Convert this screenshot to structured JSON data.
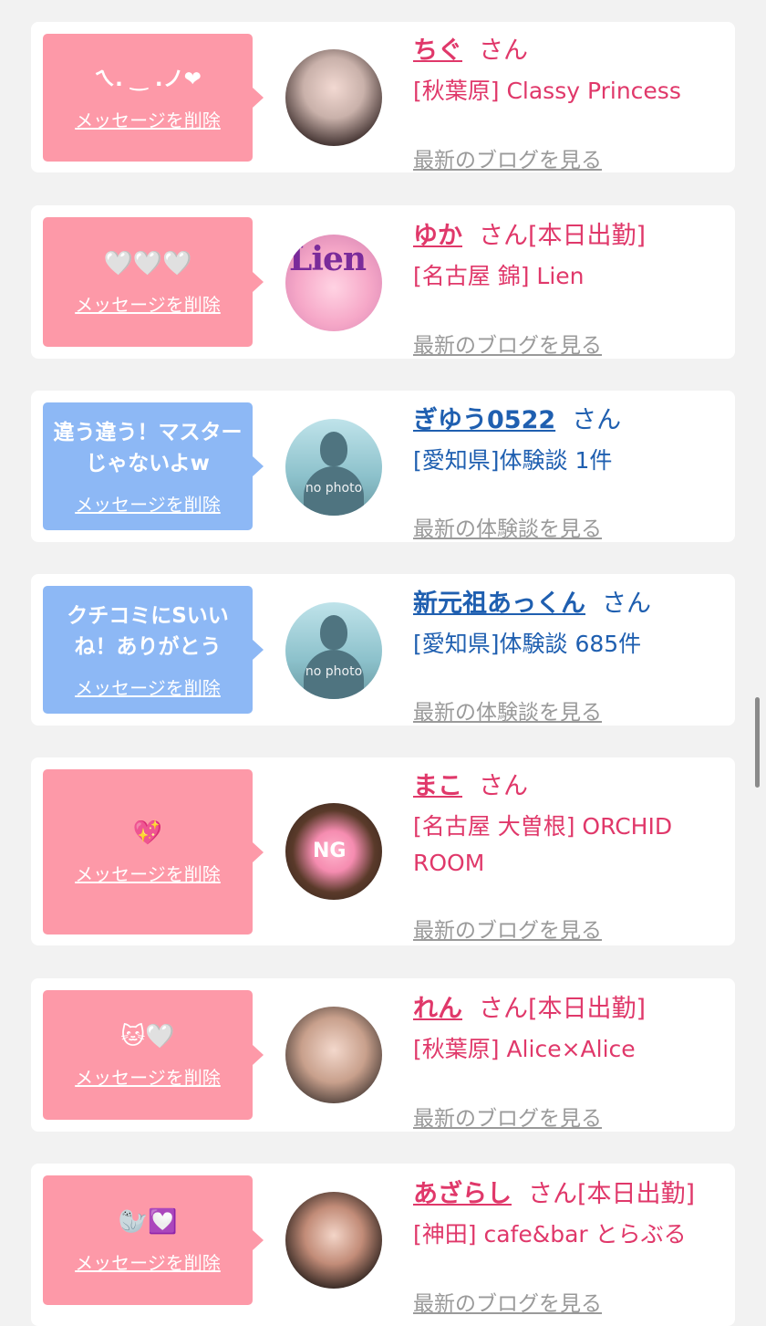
{
  "colors": {
    "pink_bubble": "#fd99a8",
    "blue_bubble": "#8db8f5",
    "pink_text": "#e0386a",
    "blue_text": "#1f5fb0"
  },
  "cards": [
    {
      "message": "ㄟ. ‿ .ノ❤",
      "delete_label": "メッセージを削除",
      "name": "ちぐ",
      "san": "さん",
      "status": "",
      "shop": "[秋葉原] Classy Princess",
      "more_link": "最新のブログを見る"
    },
    {
      "message": "🤍🤍🤍",
      "delete_label": "メッセージを削除",
      "name": "ゆか",
      "san": "さん",
      "status": "[本日出勤]",
      "shop": "[名古屋 錦] Lien",
      "more_link": "最新のブログを見る",
      "avatar_text": "Lien"
    },
    {
      "message": "違う違う！マスターじゃないよw",
      "delete_label": "メッセージを削除",
      "name": "ぎゆう0522",
      "san": "さん",
      "status": "",
      "shop": "[愛知県]体験談 1件",
      "more_link": "最新の体験談を見る",
      "avatar_text": "no photo"
    },
    {
      "message": "クチコミにSいいね！ありがとう",
      "delete_label": "メッセージを削除",
      "name": "新元祖あっくん",
      "san": "さん",
      "status": "",
      "shop": "[愛知県]体験談 685件",
      "more_link": "最新の体験談を見る",
      "avatar_text": "no photo"
    },
    {
      "message": "💖",
      "delete_label": "メッセージを削除",
      "name": "まこ",
      "san": "さん",
      "status": "",
      "shop": "[名古屋 大曽根] ORCHID ROOM",
      "more_link": "最新のブログを見る",
      "avatar_text": "NG"
    },
    {
      "message": "🐱🤍",
      "delete_label": "メッセージを削除",
      "name": "れん",
      "san": "さん",
      "status": "[本日出勤]",
      "shop": "[秋葉原] Alice×Alice",
      "more_link": "最新のブログを見る"
    },
    {
      "message": "🦭💟",
      "delete_label": "メッセージを削除",
      "name": "あざらし",
      "san": "さん",
      "status": "[本日出勤]",
      "shop": "[神田] cafe&bar とらぶる",
      "more_link": "最新のブログを見る"
    }
  ]
}
